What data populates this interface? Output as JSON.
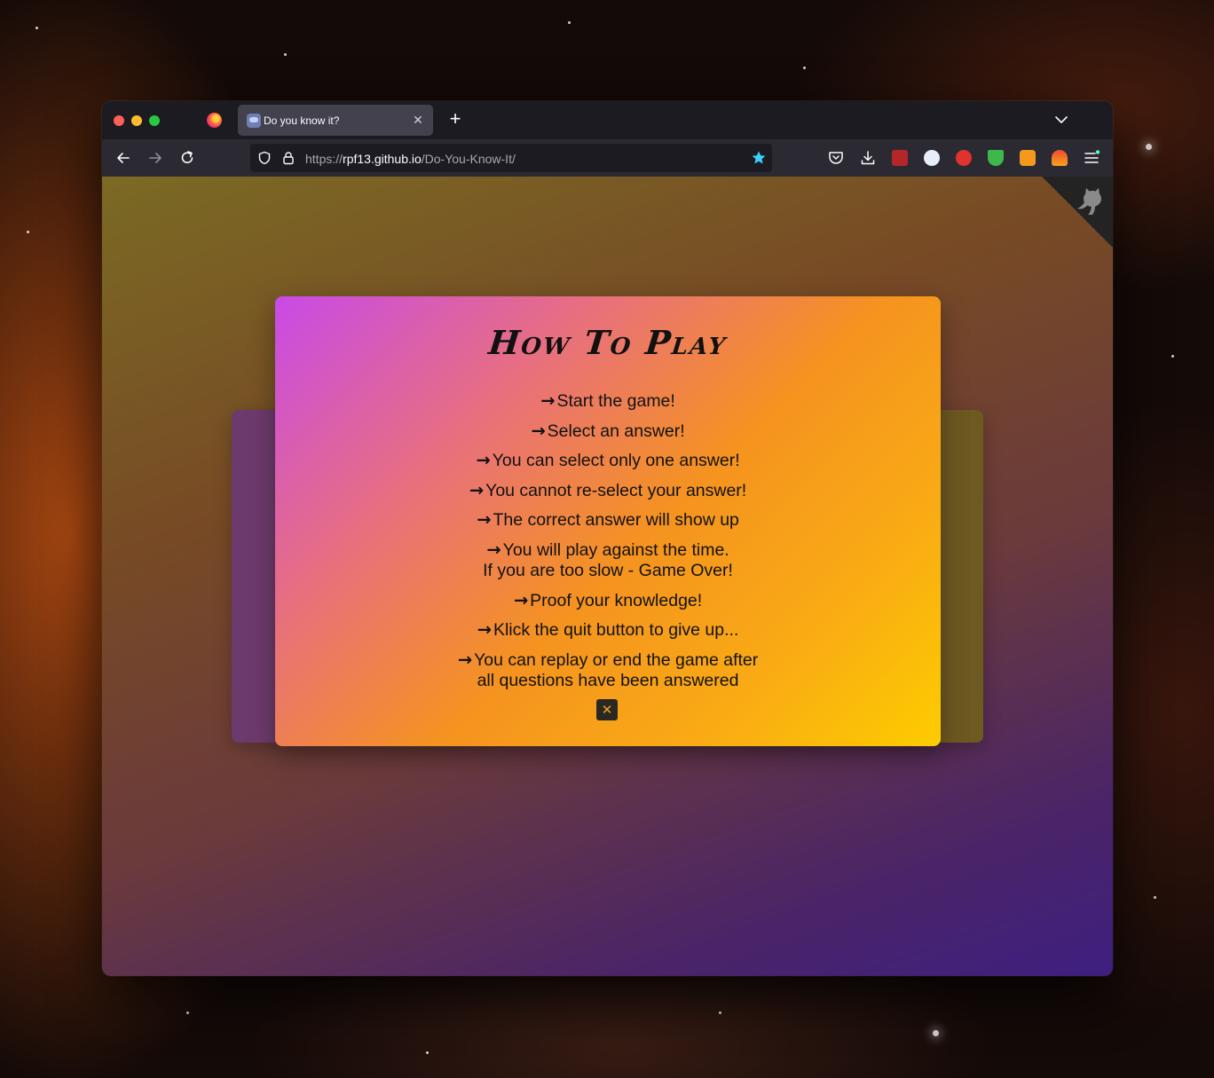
{
  "browser": {
    "tab_title": "Do you know it?",
    "tab_close": "✕",
    "new_tab": "+",
    "url_prefix": "https://",
    "url_host": "rpf13.github.io",
    "url_path": "/Do-You-Know-It/"
  },
  "modal": {
    "title": "How To Play",
    "arrow": "→",
    "rules": [
      [
        "Start the game!"
      ],
      [
        "Select an answer!"
      ],
      [
        "You can select only one answer!"
      ],
      [
        "You cannot re-select your answer!"
      ],
      [
        "The correct answer will show up"
      ],
      [
        "You will play against the time.",
        "If you are too slow - Game Over!"
      ],
      [
        "Proof your knowledge!"
      ],
      [
        "Klick the quit button to give up..."
      ],
      [
        "You can replay or end the game after",
        "all questions have been answered"
      ]
    ],
    "close_label": "✕"
  },
  "colors": {
    "accent_orange": "#f9ab14",
    "accent_magenta": "#c84ae8",
    "star_blue": "#3ad0ff"
  },
  "icons": [
    "back-arrow-icon",
    "forward-arrow-icon",
    "reload-icon",
    "shield-icon",
    "lock-icon",
    "bookmark-star-icon",
    "pocket-icon",
    "download-icon",
    "menu-icon",
    "github-octocat-icon"
  ]
}
